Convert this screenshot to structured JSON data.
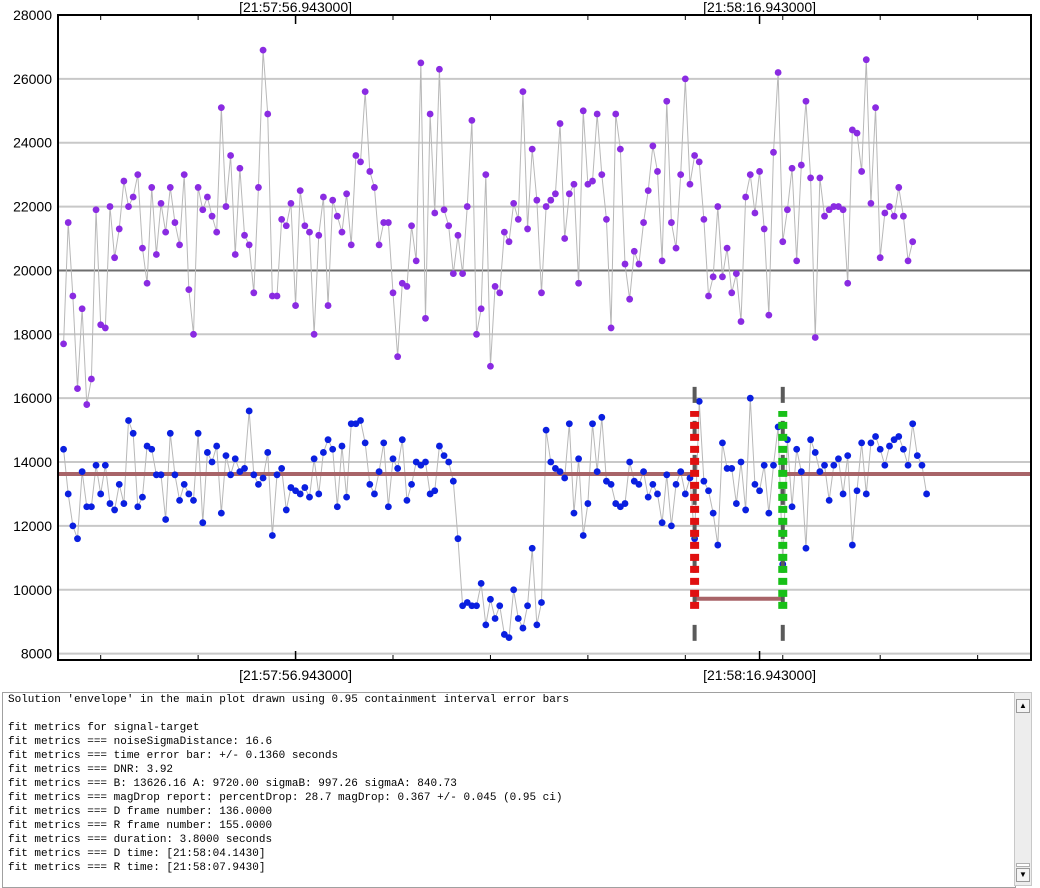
{
  "chart_data": {
    "type": "scatter",
    "ylim": [
      7800,
      28000
    ],
    "x_frame_range": [
      -1.2,
      208.5
    ],
    "y_ticks": [
      8000,
      10000,
      12000,
      14000,
      16000,
      18000,
      20000,
      22000,
      24000,
      26000,
      28000
    ],
    "y_tick_labels": [
      "8000",
      "10000",
      "12000",
      "14000",
      "16000",
      "18000",
      "20000",
      "22000",
      "24000",
      "26000",
      "28000"
    ],
    "x_label_frames": [
      50,
      150
    ],
    "top_x_labels": [
      "[21:57:56.943000]",
      "[21:58:16.943000]"
    ],
    "bottom_x_labels": [
      "[21:57:56.943000]",
      "[21:58:16.943000]"
    ],
    "minor_tick_frames": [
      8,
      29,
      50,
      71,
      92,
      113,
      134,
      155,
      176,
      197
    ],
    "grid": true,
    "reference_line_y": 20000,
    "series": [
      {
        "color": "#8a2be2",
        "values": [
          17700,
          21500,
          19200,
          16300,
          18800,
          15800,
          16600,
          21900,
          18300,
          18200,
          22000,
          20400,
          21300,
          22800,
          22000,
          22300,
          23000,
          20700,
          19600,
          22600,
          20500,
          22100,
          21200,
          22600,
          21500,
          20800,
          23000,
          19400,
          18000,
          22600,
          21900,
          22300,
          21700,
          21200,
          25100,
          22000,
          23600,
          20500,
          23200,
          21100,
          20800,
          19300,
          22600,
          26900,
          24900,
          19200,
          19200,
          21600,
          21400,
          22100,
          18900,
          22500,
          21400,
          21200,
          18000,
          21100,
          22300,
          18900,
          22200,
          21700,
          21200,
          22400,
          20800,
          23600,
          23400,
          25600,
          23100,
          22600,
          20800,
          21500,
          21500,
          19300,
          17300,
          19600,
          19500,
          21400,
          20300,
          26500,
          18500,
          24900,
          21800,
          26300,
          21900,
          21400,
          19900,
          21100,
          19900,
          22000,
          24700,
          18000,
          18800,
          23000,
          17000,
          19500,
          19300,
          21200,
          20900,
          22100,
          21600,
          25600,
          21300,
          23800,
          22200,
          19300,
          22000,
          22200,
          22400,
          24600,
          21000,
          22400,
          22700,
          19600,
          25000,
          22700,
          22800,
          24900,
          23000,
          21600,
          18200,
          24900,
          23800,
          20200,
          19100,
          20600,
          20200,
          21500,
          22500,
          23900,
          23100,
          20300,
          25300,
          21500,
          20700,
          23000,
          26000,
          22700,
          23600,
          23400,
          21600,
          19200,
          19800,
          22000,
          19800,
          20700,
          19300,
          19900,
          18400,
          22300,
          23000,
          21800,
          23100,
          21300,
          18600,
          23700,
          26200,
          20900,
          21900,
          23200,
          20300,
          23300,
          25300,
          22900,
          17900,
          22900,
          21700,
          21900,
          22000,
          22000,
          21900,
          19600,
          24400,
          24300,
          23100,
          26600,
          22100,
          25100,
          20400,
          21800,
          22000,
          21700,
          22600,
          21700,
          20300,
          20900
        ]
      },
      {
        "color": "#0a1fe0",
        "values": [
          14400,
          13000,
          12000,
          11600,
          13700,
          12600,
          12600,
          13900,
          13000,
          13900,
          12700,
          12500,
          13300,
          12700,
          15300,
          14900,
          12600,
          12900,
          14500,
          14400,
          13600,
          13600,
          12200,
          14900,
          13600,
          12800,
          13300,
          13000,
          12800,
          14900,
          12100,
          14300,
          14000,
          14500,
          12400,
          14200,
          13600,
          14100,
          13700,
          13800,
          15600,
          13600,
          13300,
          13500,
          14300,
          11700,
          13600,
          13800,
          12500,
          13200,
          13100,
          13000,
          13200,
          12900,
          14100,
          13000,
          14300,
          14700,
          14400,
          12600,
          14500,
          12900,
          15200,
          15200,
          15300,
          14600,
          13300,
          13000,
          13700,
          14600,
          12600,
          14100,
          13800,
          14700,
          12800,
          13300,
          14000,
          13900,
          14000,
          13000,
          13100,
          14500,
          14200,
          14000,
          13400,
          11600,
          9500,
          9600,
          9500,
          9500,
          10200,
          8900,
          9700,
          9100,
          9500,
          8600,
          8500,
          10000,
          9100,
          8800,
          9500,
          11300,
          8900,
          9600,
          15000,
          14000,
          13800,
          13700,
          13500,
          15200,
          12400,
          14100,
          11700,
          12700,
          15200,
          13700,
          15400,
          13400,
          13300,
          12700,
          12600,
          12700,
          14000,
          13400,
          13300,
          13700,
          12900,
          13300,
          13000,
          12100,
          13600,
          12000,
          13300,
          13700,
          13000,
          13500,
          11600,
          15900,
          13400,
          13100,
          12400,
          11400,
          14600,
          13800,
          13800,
          12700,
          14000,
          12500,
          16000,
          13300,
          13100,
          13900,
          12400,
          13900,
          15100,
          10800,
          14700,
          12600,
          14400,
          13700,
          11300,
          14700,
          14300,
          13700,
          13900,
          12800,
          13900,
          14100,
          13000,
          14200,
          11400,
          13100,
          14600,
          13000,
          14600,
          14800,
          14400,
          13900,
          14500,
          14700,
          14800,
          14400,
          13900,
          15200,
          14200,
          13900,
          13000
        ]
      }
    ],
    "baseline_B": {
      "value": 13626.16,
      "color": "#a86468"
    },
    "event_A": {
      "value": 9720.0,
      "from_frame": 136,
      "to_frame": 155
    },
    "d_edge": {
      "frame": 136,
      "color": "#e01010",
      "y_low": 9400,
      "y_high": 15600
    },
    "r_edge": {
      "frame": 155,
      "color": "#18c018",
      "y_low": 9400,
      "y_high": 15600
    },
    "edge_markers": {
      "color": "#5a5a5a",
      "y_low": 8400,
      "y_high": 16700
    }
  },
  "log": {
    "lines": [
      "Solution 'envelope' in the main plot drawn using 0.95 containment interval error bars",
      "",
      "fit metrics for signal-target",
      "fit metrics === noiseSigmaDistance: 16.6",
      "fit metrics === time error bar: +/- 0.1360 seconds",
      "fit metrics === DNR: 3.92",
      "fit metrics === B: 13626.16 A: 9720.00 sigmaB: 997.26 sigmaA: 840.73",
      "fit metrics === magDrop report: percentDrop: 28.7 magDrop: 0.367 +/- 0.045 (0.95 ci)",
      "fit metrics === D frame number: 136.0000",
      "fit metrics === R frame number: 155.0000",
      "fit metrics === duration: 3.8000 seconds",
      "fit metrics === D time: [21:58:04.1430]",
      "fit metrics === R time: [21:58:07.9430]"
    ],
    "scroll_up_icon": "arrow-up-icon",
    "scroll_down_icon": "arrow-down-icon"
  }
}
